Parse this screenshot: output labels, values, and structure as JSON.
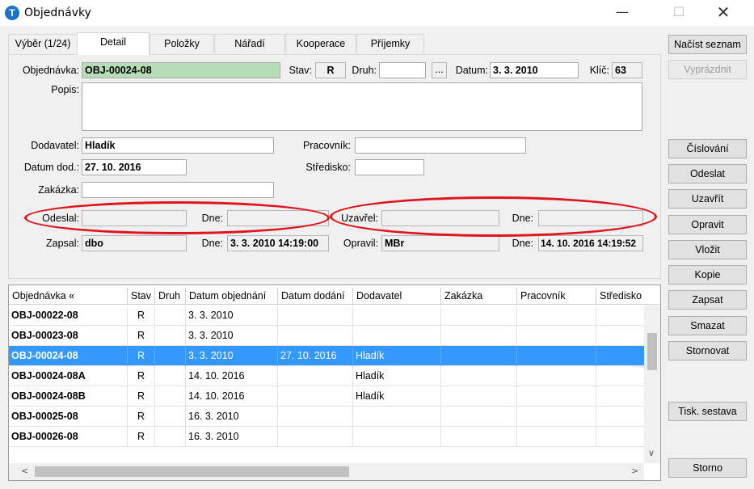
{
  "window": {
    "title": "Objednávky",
    "min": "—",
    "max": "☐",
    "close": "✕"
  },
  "tabs": [
    "Výběr (1/24)",
    "Detail",
    "Položky",
    "Nářadí",
    "Kooperace",
    "Příjemky"
  ],
  "form": {
    "objednavka_label": "Objednávka:",
    "objednavka": "OBJ-00024-08",
    "stav_label": "Stav:",
    "stav": "R",
    "druh_label": "Druh:",
    "druh": "",
    "browse": "...",
    "datum_label": "Datum:",
    "datum": "3. 3. 2010",
    "klic_label": "Klíč:",
    "klic": "63",
    "popis_label": "Popis:",
    "popis": "",
    "dodavatel_label": "Dodavatel:",
    "dodavatel": "Hladík",
    "pracovnik_label": "Pracovník:",
    "pracovnik": "",
    "datum_dod_label": "Datum dod.:",
    "datum_dod": "27. 10. 2016",
    "stredisko_label": "Středisko:",
    "stredisko": "",
    "zakazka_label": "Zakázka:",
    "zakazka": "",
    "odeslal_label": "Odeslal:",
    "odeslal": "",
    "dne1_label": "Dne:",
    "dne1": "",
    "uzavrel_label": "Uzavřel:",
    "uzavrel": "",
    "dne2_label": "Dne:",
    "dne2": "",
    "zapsal_label": "Zapsal:",
    "zapsal": "dbo",
    "dne3_label": "Dne:",
    "dne3": "3. 3. 2010 14:19:00",
    "opravil_label": "Opravil:",
    "opravil": "MBr",
    "dne4_label": "Dne:",
    "dne4": "14. 10. 2016 14:19:52"
  },
  "buttons": {
    "nacist": "Načíst seznam",
    "vyprazdnit": "Vyprázdnit",
    "cislovani": "Číslování",
    "odeslat": "Odeslat",
    "uzavrit": "Uzavřít",
    "opravit": "Opravit",
    "vlozit": "Vložit",
    "kopie": "Kopie",
    "zapsat": "Zapsat",
    "smazat": "Smazat",
    "stornovat": "Stornovat",
    "tisk": "Tisk. sestava",
    "storno": "Storno"
  },
  "grid": {
    "columns": [
      "Objednávka «",
      "Stav",
      "Druh",
      "Datum objednání",
      "Datum dodání",
      "Dodavatel",
      "Zakázka",
      "Pracovník",
      "Středisko"
    ],
    "rows": [
      [
        "OBJ-00022-08",
        "R",
        "",
        "3. 3. 2010",
        "",
        "",
        "",
        "",
        ""
      ],
      [
        "OBJ-00023-08",
        "R",
        "",
        "3. 3. 2010",
        "",
        "",
        "",
        "",
        ""
      ],
      [
        "OBJ-00024-08",
        "R",
        "",
        "3. 3. 2010",
        "27. 10. 2016",
        "Hladík",
        "",
        "",
        ""
      ],
      [
        "OBJ-00024-08A",
        "R",
        "",
        "14. 10. 2016",
        "",
        "Hladík",
        "",
        "",
        ""
      ],
      [
        "OBJ-00024-08B",
        "R",
        "",
        "14. 10. 2016",
        "",
        "Hladík",
        "",
        "",
        ""
      ],
      [
        "OBJ-00025-08",
        "R",
        "",
        "16. 3. 2010",
        "",
        "",
        "",
        "",
        ""
      ],
      [
        "OBJ-00026-08",
        "R",
        "",
        "16. 3. 2010",
        "",
        "",
        "",
        "",
        ""
      ]
    ],
    "selected_row": 2,
    "scroll_left": "<",
    "scroll_right": ">",
    "scroll_down": "∨"
  },
  "colors": {
    "selection": "#3399ff",
    "highlight_oval": "#e0141c",
    "objednavka_field": "#b7ddb7"
  }
}
